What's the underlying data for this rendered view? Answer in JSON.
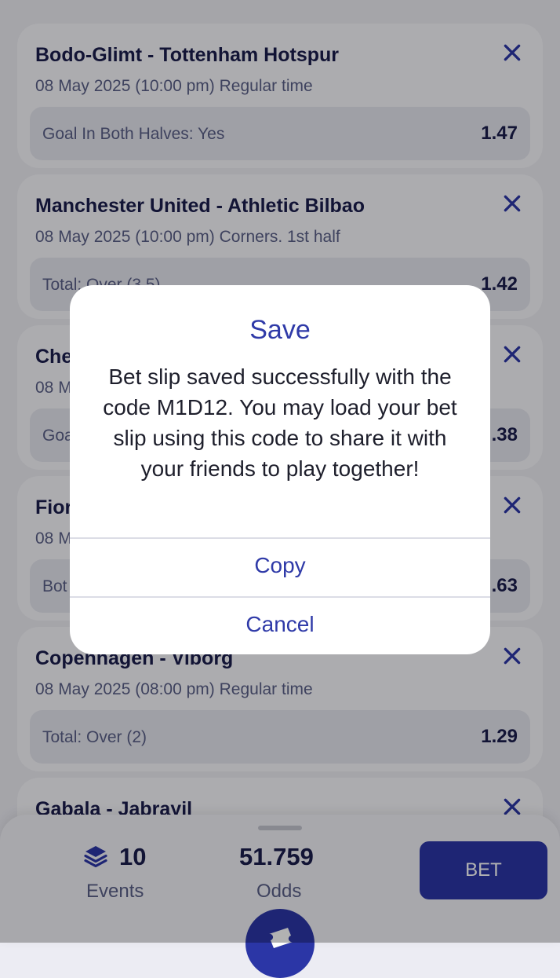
{
  "bets": [
    {
      "match": "Bodo-Glimt - Tottenham Hotspur",
      "meta": "08 May 2025 (10:00 pm) Regular time",
      "market": "Goal In Both Halves: Yes",
      "odds": "1.47"
    },
    {
      "match": "Manchester United - Athletic Bilbao",
      "meta": "08 May 2025 (10:00 pm) Corners. 1st half",
      "market": "Total: Over (3.5)",
      "odds": "1.42"
    },
    {
      "match": "Che",
      "meta": "08 M",
      "market": "Goa",
      "odds": ".38"
    },
    {
      "match": "Fior",
      "meta": "08 M",
      "market": "Bot",
      "odds": ".63"
    },
    {
      "match": "Copenhagen - Viborg",
      "meta": "08 May 2025 (08:00 pm) Regular time",
      "market": "Total: Over (2)",
      "odds": "1.29"
    },
    {
      "match": "Gabala - Jabrayil",
      "meta": "",
      "market": "",
      "odds": ""
    }
  ],
  "summary": {
    "events_count": "10",
    "events_label": "Events",
    "odds_value": "51.759",
    "odds_label": "Odds",
    "bet_label": "BET"
  },
  "dialog": {
    "title": "Save",
    "message": "Bet slip saved successfully with the code M1D12. You may load your bet slip using this code to share it with your friends to play together!",
    "copy_label": "Copy",
    "cancel_label": "Cancel"
  },
  "icons": [
    "close-icon",
    "layers-icon",
    "ticket-icon"
  ],
  "colors": {
    "accent": "#2b36a6",
    "dialog_text": "#2f3aa8",
    "title": "#1b1d4d",
    "muted": "#5a5f87"
  }
}
